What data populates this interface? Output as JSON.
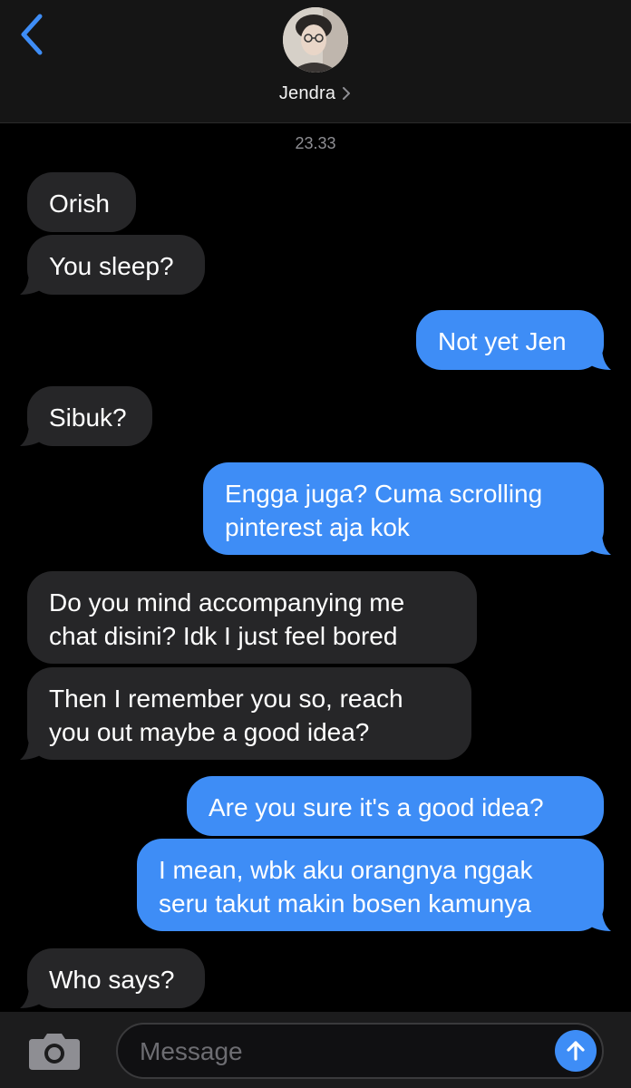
{
  "header": {
    "contact_name": "Jendra",
    "back_icon": "chevron-left-icon",
    "accent_color": "#3e8df6"
  },
  "timestamp": "23.33",
  "messages": [
    {
      "from": "received",
      "lines": [
        "Orish"
      ]
    },
    {
      "from": "received",
      "lines": [
        "You sleep?"
      ]
    },
    {
      "from": "sent",
      "lines": [
        "Not yet Jen"
      ]
    },
    {
      "from": "received",
      "lines": [
        "Sibuk?"
      ]
    },
    {
      "from": "sent",
      "lines": [
        "Engga juga? Cuma scrolling",
        "pinterest aja kok"
      ]
    },
    {
      "from": "received",
      "lines": [
        "Do you mind accompanying me",
        "chat disini? Idk I just feel bored"
      ]
    },
    {
      "from": "received",
      "lines": [
        "Then I remember you so, reach",
        "you out maybe a good idea?"
      ]
    },
    {
      "from": "sent",
      "lines": [
        "Are you sure it's a good idea?"
      ]
    },
    {
      "from": "sent",
      "lines": [
        "I mean, wbk aku orangnya nggak",
        "seru takut makin bosen kamunya"
      ]
    },
    {
      "from": "received",
      "lines": [
        "Who says?"
      ]
    }
  ],
  "input": {
    "placeholder": "Message",
    "value": ""
  },
  "colors": {
    "sent_bubble": "#3e8df6",
    "received_bubble": "#262628",
    "background": "#000000"
  }
}
